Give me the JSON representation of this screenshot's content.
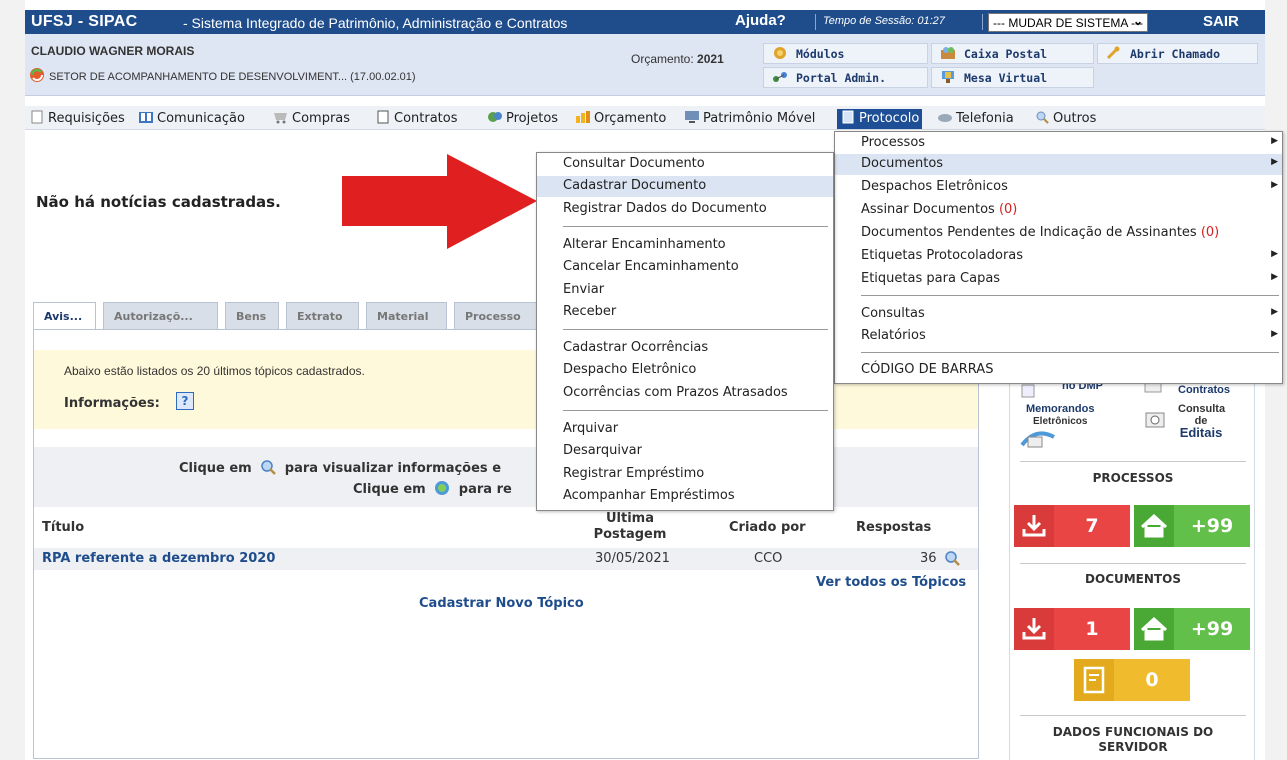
{
  "header": {
    "app_name": "UFSJ - SIPAC",
    "system_name": "- Sistema Integrado de Patrimônio, Administração e Contratos",
    "help_label": "Ajuda?",
    "session_label": "Tempo de Sessão: 01:27",
    "change_system_label": "--- MUDAR DE SISTEMA ---",
    "exit_label": "SAIR"
  },
  "user": {
    "name": "CLAUDIO WAGNER MORAIS",
    "department": "SETOR DE ACOMPANHAMENTO DE DESENVOLVIMENT... (17.00.02.01)",
    "budget_label": "Orçamento:",
    "budget_year": "2021"
  },
  "quick_links": {
    "modules": "Módulos",
    "mailbox": "Caixa Postal",
    "open_ticket": "Abrir Chamado",
    "admin_portal": "Portal Admin.",
    "virtual_desk": "Mesa Virtual"
  },
  "menu": {
    "requisicoes": "Requisições",
    "comunicacao": "Comunicação",
    "compras": "Compras",
    "contratos": "Contratos",
    "projetos": "Projetos",
    "orcamento": "Orçamento",
    "patrimonio": "Patrimônio Móvel",
    "protocolo": "Protocolo",
    "telefonia": "Telefonia",
    "outros": "Outros"
  },
  "news_text": "Não há notícias cadastradas.",
  "tabs": {
    "avisos": "Avis...",
    "autorizacoes": "Autorizaçõ...",
    "bens": "Bens",
    "extrato": "Extrato",
    "material": "Material",
    "processos": "Processo"
  },
  "forum": {
    "intro": "Abaixo estão listados os 20 últimos tópicos cadastrados.",
    "info_label": "Informações:",
    "help_glyph": "?",
    "click_line_1_prefix": "Clique em",
    "click_line_1_suffix": "para visualizar informações e",
    "click_line_2_prefix": "Clique em",
    "click_line_2_suffix": "para re",
    "col_title": "Título",
    "col_last_post": "Última\nPostagem",
    "col_last_post_1": "Última",
    "col_last_post_2": "Postagem",
    "col_created_by": "Criado por",
    "col_replies": "Respostas",
    "rows": [
      {
        "title": "RPA referente a dezembro 2020",
        "last_post": "30/05/2021",
        "created_by": "CCO",
        "replies": "36"
      }
    ],
    "see_all": "Ver todos os Tópicos",
    "new_topic": "Cadastrar Novo Tópico"
  },
  "sidebar": {
    "dmp": "no DMP",
    "contracts": "Contratos",
    "memos_1": "Memorandos",
    "memos_2": "Eletrônicos",
    "editais_1": "Consulta",
    "editais_2": "de",
    "editais_3": "Editais",
    "processes_title": "PROCESSOS",
    "processes_inbox": "7",
    "processes_home": "+99",
    "documents_title": "DOCUMENTOS",
    "documents_inbox": "1",
    "documents_home": "+99",
    "documents_pending": "0",
    "functional_title_1": "DADOS FUNCIONAIS DO",
    "functional_title_2": "SERVIDOR"
  },
  "protocolo_menu": {
    "processos": "Processos",
    "documentos": "Documentos",
    "despachos": "Despachos Eletrônicos",
    "assinar": "Assinar Documentos",
    "assinar_count": "(0)",
    "pendentes": "Documentos Pendentes de Indicação de Assinantes",
    "pendentes_count": "(0)",
    "etiquetas_prot": "Etiquetas Protocoladoras",
    "etiquetas_capas": "Etiquetas para Capas",
    "consultas": "Consultas",
    "relatorios": "Relatórios",
    "codigo_barras": "CÓDIGO DE BARRAS",
    "submenu_glyph": "▶"
  },
  "documentos_menu": {
    "consultar": "Consultar Documento",
    "cadastrar": "Cadastrar Documento",
    "registrar_dados": "Registrar Dados do Documento",
    "alterar_enc": "Alterar Encaminhamento",
    "cancelar_enc": "Cancelar Encaminhamento",
    "enviar": "Enviar",
    "receber": "Receber",
    "cad_ocorrencias": "Cadastrar Ocorrências",
    "despacho": "Despacho Eletrônico",
    "ocorrencias_prazos": "Ocorrências com Prazos Atrasados",
    "arquivar": "Arquivar",
    "desarquivar": "Desarquivar",
    "registrar_emp": "Registrar Empréstimo",
    "acompanhar_emp": "Acompanhar Empréstimos"
  },
  "colors": {
    "header_blue": "#1f4d8c",
    "annotation_arrow": "#e02020",
    "tile_red": "#ea4545",
    "tile_green": "#61bf4a",
    "tile_yellow": "#f0bb2c"
  }
}
